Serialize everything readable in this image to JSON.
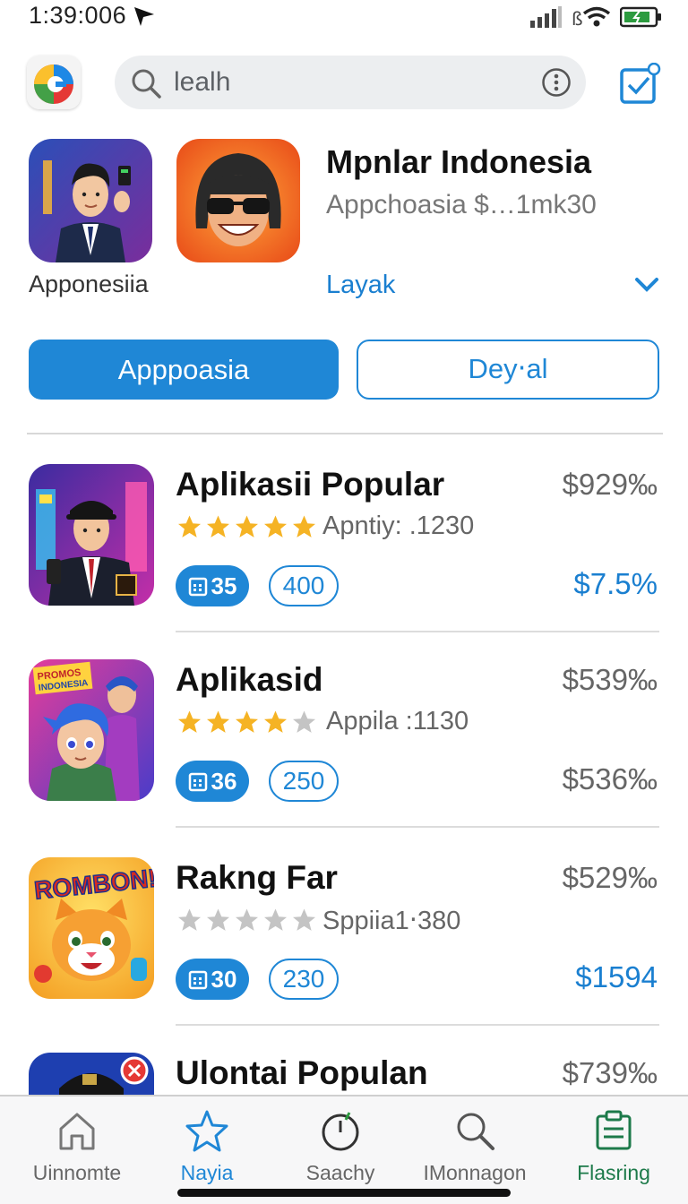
{
  "status_bar": {
    "time": "1:39:006"
  },
  "header": {
    "search_text": "lealh"
  },
  "featured": {
    "caption": "Apponesiia",
    "title": "Mpnlar Indonesia",
    "subtitle": "Appchoasia $…1mk30",
    "link": "Layak",
    "primary_button": "Apppoasia",
    "secondary_button": "Dey‧al"
  },
  "apps": [
    {
      "title": "Aplikasii Popular",
      "price": "$929‰",
      "rating": 5,
      "rating_text": "Apntiy: .1230",
      "badge_fill": "35",
      "badge_outline": "400",
      "pct": "$7.5%",
      "pct_color": "#1a7fd0"
    },
    {
      "title": "Aplikasid",
      "price": "$539‰",
      "rating": 4,
      "rating_text": "Appila :1130",
      "badge_fill": "36",
      "badge_outline": "250",
      "pct": "$536‰",
      "pct_color": "#666666"
    },
    {
      "title": "Rakng Far",
      "price": "$529‰",
      "rating": 0,
      "rating_text": "Sppiia1‧380",
      "badge_fill": "30",
      "badge_outline": "230",
      "pct": "$1594",
      "pct_color": "#1a7fd0"
    },
    {
      "title": "Ulontai Populan",
      "price": "$739‰"
    }
  ],
  "icon_texts": {
    "rombon": "ROMBON!!",
    "poster": "PROMOS INDONESIA"
  },
  "tabs": [
    {
      "label": "Uinnomte",
      "icon": "home-icon",
      "active": false
    },
    {
      "label": "Nayia",
      "icon": "star-icon",
      "active": true
    },
    {
      "label": "Saachy",
      "icon": "clock-icon",
      "active": false
    },
    {
      "label": "IMonnagon",
      "icon": "search-icon",
      "active": false
    },
    {
      "label": "Flasring",
      "icon": "clipboard-icon",
      "active": false,
      "color": "#1d7a4a"
    }
  ],
  "colors": {
    "accent": "#1f87d6",
    "star": "#f5b324",
    "star_empty": "#c4c4c4"
  }
}
